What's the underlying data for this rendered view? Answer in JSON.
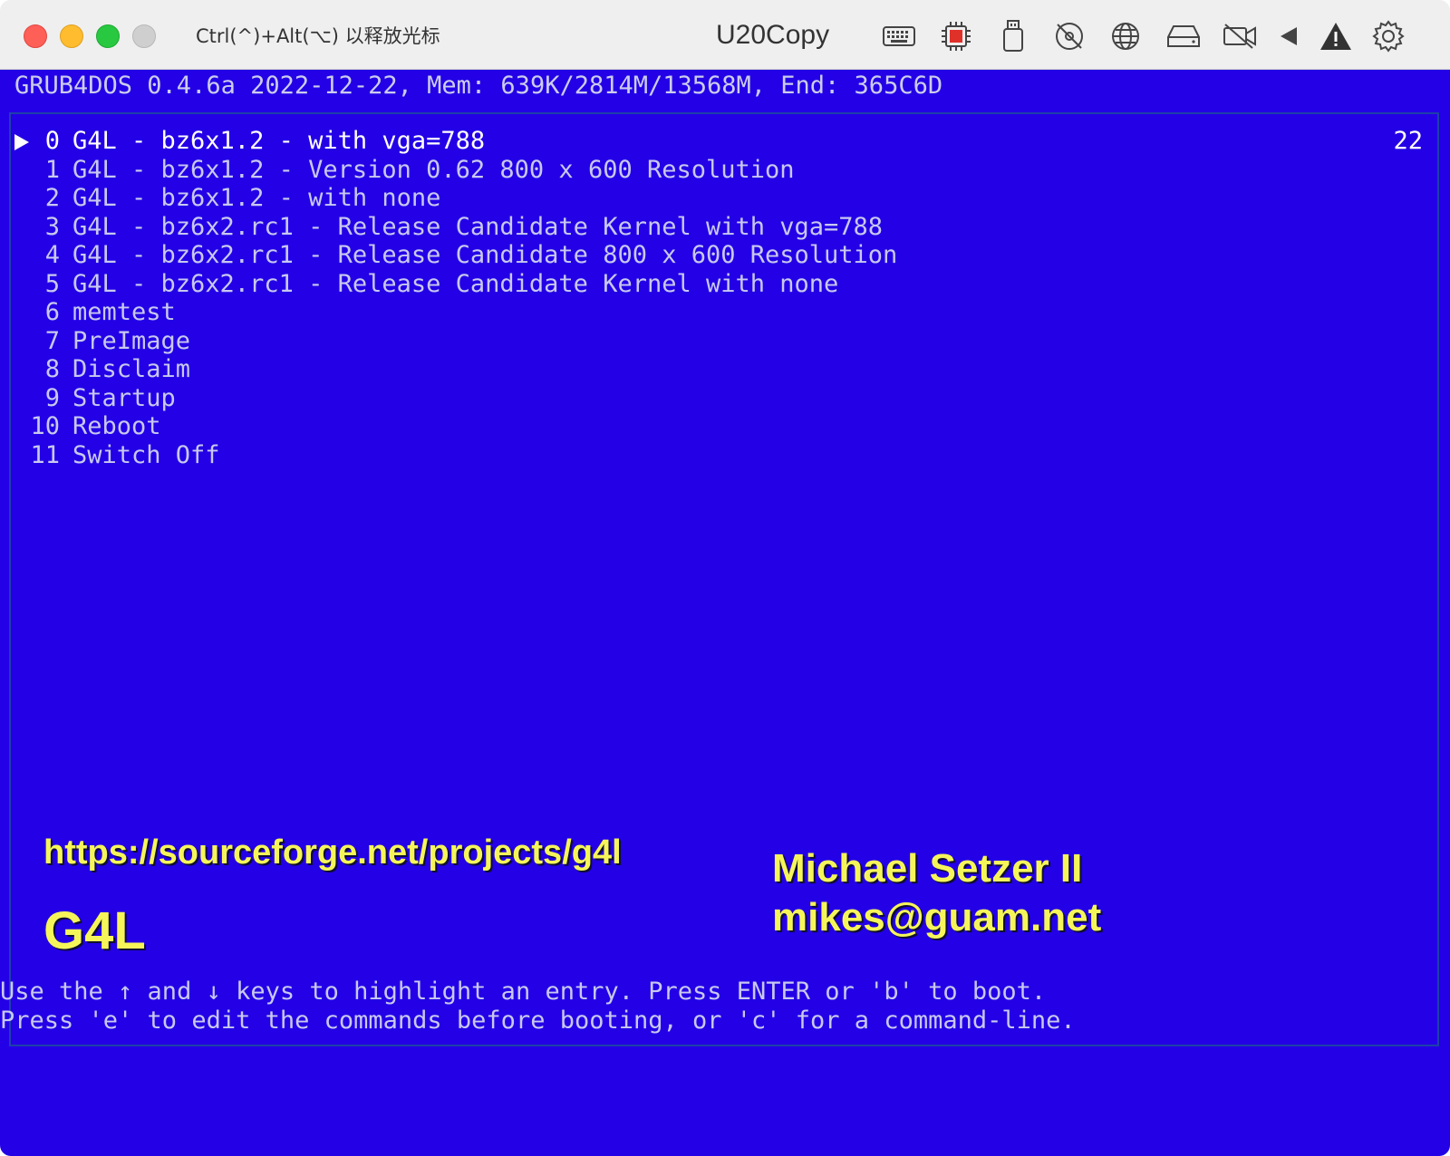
{
  "window": {
    "release_hint": "Ctrl(^)+Alt(⌥) 以释放光标",
    "title": "U20Copy",
    "toolbar_icons": [
      "keyboard-icon",
      "cpu-icon",
      "usb-icon",
      "cd-disabled-icon",
      "network-icon",
      "hard-disk-icon",
      "camera-disabled-icon",
      "audio-icon",
      "warning-icon",
      "settings-icon"
    ]
  },
  "grub": {
    "header": "GRUB4DOS 0.4.6a 2022-12-22, Mem: 639K/2814M/13568M, End: 365C6D",
    "timeout": "22",
    "entries": [
      {
        "num": "0",
        "label": "G4L - bz6x1.2 - with vga=788"
      },
      {
        "num": "1",
        "label": "G4L - bz6x1.2 - Version 0.62 800 x 600 Resolution"
      },
      {
        "num": "2",
        "label": "G4L - bz6x1.2 - with none"
      },
      {
        "num": "3",
        "label": "G4L - bz6x2.rc1 - Release Candidate Kernel with vga=788"
      },
      {
        "num": "4",
        "label": "G4L - bz6x2.rc1 - Release Candidate 800 x 600 Resolution"
      },
      {
        "num": "5",
        "label": "G4L - bz6x2.rc1 - Release Candidate Kernel with none"
      },
      {
        "num": "6",
        "label": "memtest"
      },
      {
        "num": "7",
        "label": "PreImage"
      },
      {
        "num": "8",
        "label": "Disclaim"
      },
      {
        "num": "9",
        "label": "Startup"
      },
      {
        "num": "10",
        "label": "Reboot"
      },
      {
        "num": "11",
        "label": "Switch Off"
      }
    ],
    "splash": {
      "url": "https://sourceforge.net/projects/g4l",
      "product": "G4L",
      "author": "Michael Setzer II",
      "email": "mikes@guam.net"
    },
    "help_line_1": "Use the ↑ and ↓ keys to highlight an entry. Press ENTER or 'b' to boot.",
    "help_line_2": "Press 'e' to edit the commands before booting, or 'c' for a command-line."
  },
  "colors": {
    "screen_bg": "#2300e6",
    "entry_text": "#c8c8f0",
    "selected_text": "#ffffff",
    "splash_text": "#f5f55a"
  }
}
